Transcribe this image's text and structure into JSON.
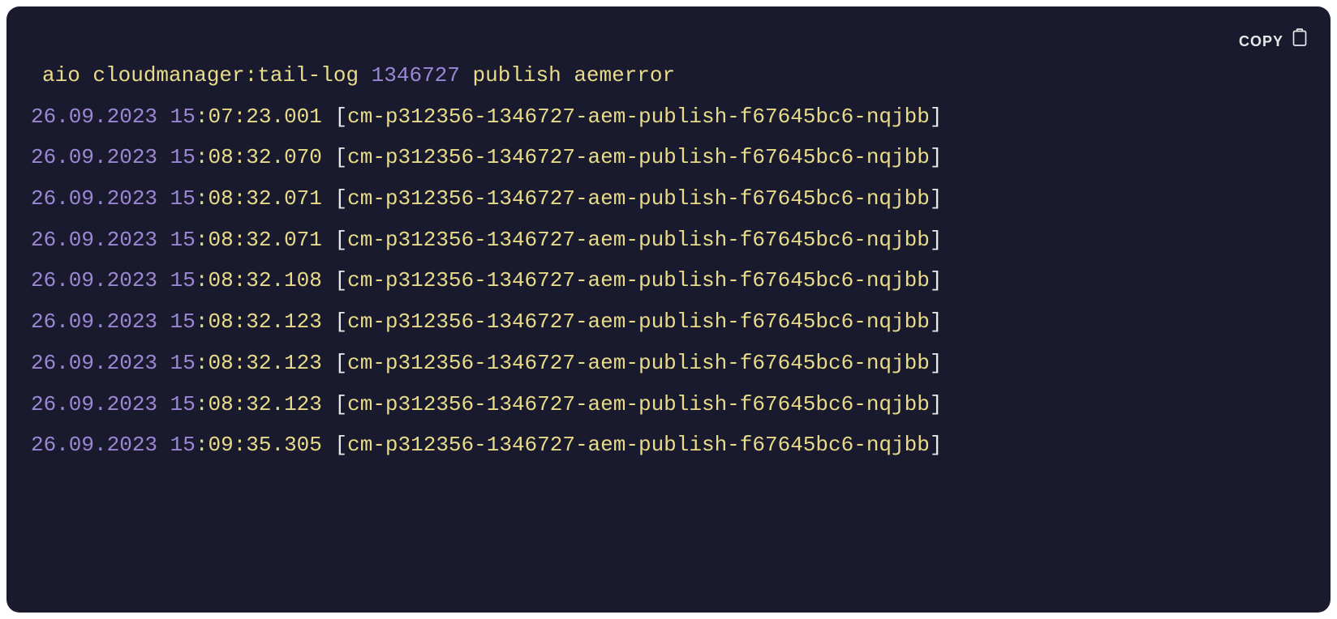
{
  "copy_label": "COPY",
  "command": {
    "prefix": "aio cloudmanager:tail-log ",
    "number": "1346727",
    "suffix": " publish aemerror"
  },
  "logs": [
    {
      "date": "26.09.2023 ",
      "hour": "15",
      "rest_time": ":07:23.001",
      "source": "cm-p312356-1346727-aem-publish-f67645bc6-nqjbb"
    },
    {
      "date": "26.09.2023 ",
      "hour": "15",
      "rest_time": ":08:32.070",
      "source": "cm-p312356-1346727-aem-publish-f67645bc6-nqjbb"
    },
    {
      "date": "26.09.2023 ",
      "hour": "15",
      "rest_time": ":08:32.071",
      "source": "cm-p312356-1346727-aem-publish-f67645bc6-nqjbb"
    },
    {
      "date": "26.09.2023 ",
      "hour": "15",
      "rest_time": ":08:32.071",
      "source": "cm-p312356-1346727-aem-publish-f67645bc6-nqjbb"
    },
    {
      "date": "26.09.2023 ",
      "hour": "15",
      "rest_time": ":08:32.108",
      "source": "cm-p312356-1346727-aem-publish-f67645bc6-nqjbb"
    },
    {
      "date": "26.09.2023 ",
      "hour": "15",
      "rest_time": ":08:32.123",
      "source": "cm-p312356-1346727-aem-publish-f67645bc6-nqjbb"
    },
    {
      "date": "26.09.2023 ",
      "hour": "15",
      "rest_time": ":08:32.123",
      "source": "cm-p312356-1346727-aem-publish-f67645bc6-nqjbb"
    },
    {
      "date": "26.09.2023 ",
      "hour": "15",
      "rest_time": ":08:32.123",
      "source": "cm-p312356-1346727-aem-publish-f67645bc6-nqjbb"
    },
    {
      "date": "26.09.2023 ",
      "hour": "15",
      "rest_time": ":09:35.305",
      "source": "cm-p312356-1346727-aem-publish-f67645bc6-nqjbb"
    }
  ]
}
